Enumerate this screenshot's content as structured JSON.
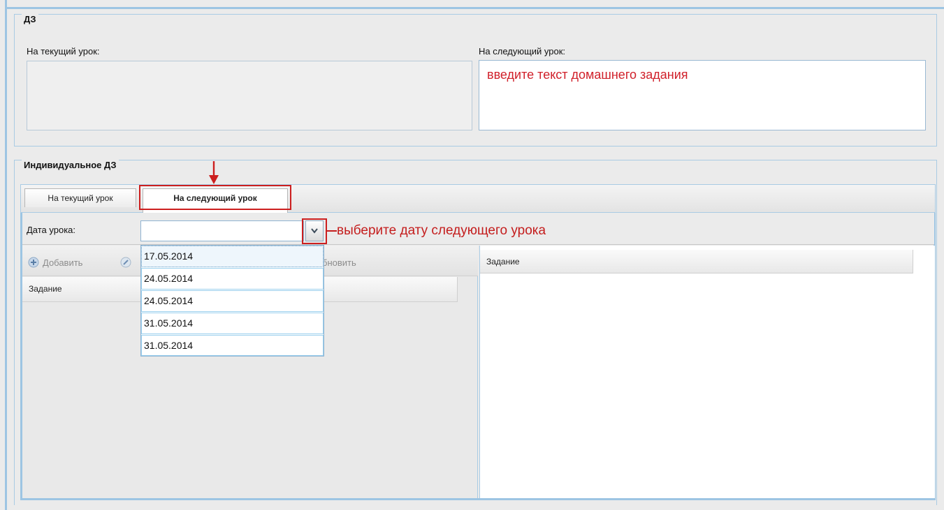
{
  "hw_section": {
    "title": "ДЗ",
    "current_label": "На текущий урок:",
    "next_label": "На следующий урок:",
    "next_textarea_value": "введите текст домашнего задания"
  },
  "individual_section": {
    "title": "Индивидуальное ДЗ",
    "tabs": [
      {
        "label": "На текущий урок",
        "active": false
      },
      {
        "label": "На следующий урок",
        "active": true
      }
    ],
    "date_label": "Дата урока:",
    "date_value": "",
    "date_options": [
      "17.05.2014",
      "24.05.2014",
      "24.05.2014",
      "31.05.2014",
      "31.05.2014"
    ],
    "toolbar": {
      "add_label": "Добавить",
      "refresh_label_partial": "бновить"
    },
    "left_grid_header": "Задание",
    "right_grid_header": "Задание"
  },
  "annotations": {
    "date_hint": "выберите дату следующего урока"
  },
  "colors": {
    "annotation_red": "#cc1f1f",
    "frame_blue": "#9dc5e3"
  },
  "icons": [
    "add-icon",
    "edit-icon",
    "chevron-down-icon",
    "arrow-down-icon"
  ]
}
